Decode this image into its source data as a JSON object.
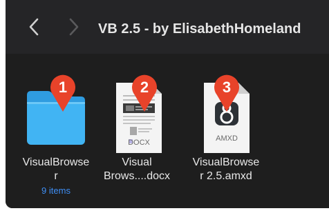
{
  "window": {
    "title": "VB 2.5 - by ElisabethHomeland"
  },
  "colors": {
    "badge": "#e8432a",
    "folder": "#41b4f3",
    "subtitle": "#3f8ff6"
  },
  "items": [
    {
      "badge": "1",
      "icon": "folder-icon",
      "label": "VisualBrowse\nr",
      "sublabel": "9 items"
    },
    {
      "badge": "2",
      "icon": "docx-file-icon",
      "file_tag": "DOCX",
      "label": "Visual\nBrows....docx"
    },
    {
      "badge": "3",
      "icon": "amxd-file-icon",
      "file_tag": "AMXD",
      "label": "VisualBrowse\nr 2.5.amxd"
    }
  ]
}
